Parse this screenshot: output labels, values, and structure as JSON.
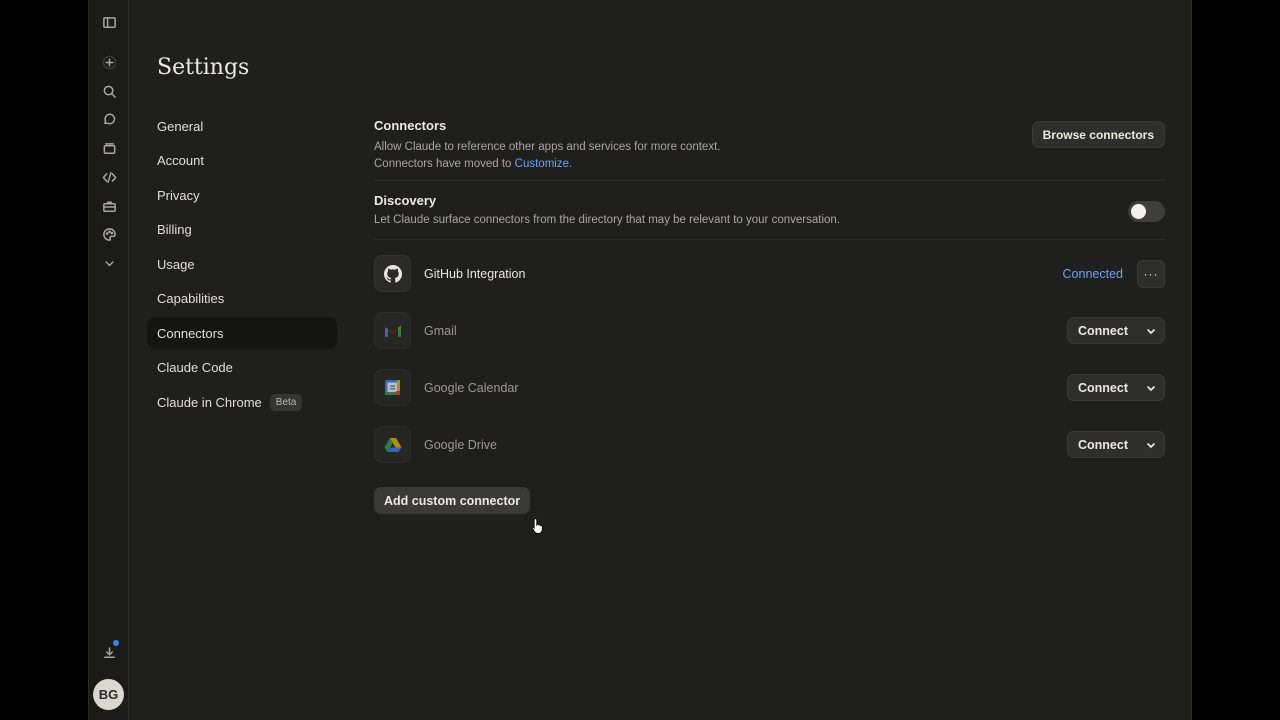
{
  "page_title": "Settings",
  "user": {
    "initials": "BG"
  },
  "rail": {
    "icons": [
      "sidebar-toggle-icon",
      "new-chat-icon",
      "search-icon",
      "chats-icon",
      "projects-icon",
      "code-icon",
      "briefcase-icon",
      "palette-icon",
      "chevron-down-icon",
      "download-icon"
    ]
  },
  "nav": {
    "items": [
      {
        "label": "General"
      },
      {
        "label": "Account"
      },
      {
        "label": "Privacy"
      },
      {
        "label": "Billing"
      },
      {
        "label": "Usage"
      },
      {
        "label": "Capabilities"
      },
      {
        "label": "Connectors",
        "active": true
      },
      {
        "label": "Claude Code"
      },
      {
        "label": "Claude in Chrome",
        "badge": "Beta"
      }
    ]
  },
  "connectors": {
    "title": "Connectors",
    "desc_line1": "Allow Claude to reference other apps and services for more context.",
    "desc_line2_prefix": "Connectors have moved to",
    "desc_link": "Customize.",
    "browse_label": "Browse connectors"
  },
  "discovery": {
    "title": "Discovery",
    "desc": "Let Claude surface connectors from the directory that may be relevant to your conversation.",
    "enabled": false
  },
  "connector_list": [
    {
      "name": "GitHub Integration",
      "icon": "github-icon",
      "status": "Connected",
      "more_label": "···"
    },
    {
      "name": "Gmail",
      "icon": "gmail-icon",
      "action": "Connect"
    },
    {
      "name": "Google Calendar",
      "icon": "google-calendar-icon",
      "action": "Connect"
    },
    {
      "name": "Google Drive",
      "icon": "google-drive-icon",
      "action": "Connect"
    }
  ],
  "add_custom_label": "Add custom connector",
  "colors": {
    "accent_link": "#6fa2f0",
    "background": "#1f1f1e",
    "notification": "#3b82f6"
  }
}
